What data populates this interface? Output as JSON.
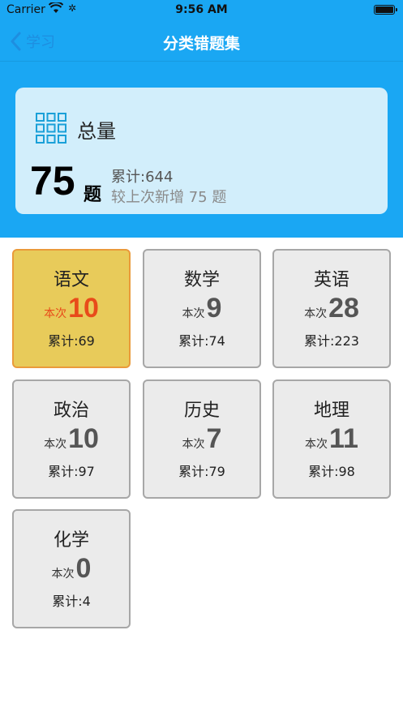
{
  "status_bar": {
    "carrier": "Carrier",
    "time": "9:56 AM"
  },
  "nav": {
    "back_label": "学习",
    "title": "分类错题集"
  },
  "summary": {
    "label": "总量",
    "count": "75",
    "unit": "题",
    "cumulative": "累计:644",
    "increase": "较上次新增 75 题"
  },
  "subjects": [
    {
      "name": "语文",
      "this_label": "本次",
      "count": "10",
      "total": "累计:69",
      "active": true
    },
    {
      "name": "数学",
      "this_label": "本次",
      "count": "9",
      "total": "累计:74",
      "active": false
    },
    {
      "name": "英语",
      "this_label": "本次",
      "count": "28",
      "total": "累计:223",
      "active": false
    },
    {
      "name": "政治",
      "this_label": "本次",
      "count": "10",
      "total": "累计:97",
      "active": false
    },
    {
      "name": "历史",
      "this_label": "本次",
      "count": "7",
      "total": "累计:79",
      "active": false
    },
    {
      "name": "地理",
      "this_label": "本次",
      "count": "11",
      "total": "累计:98",
      "active": false
    },
    {
      "name": "化学",
      "this_label": "本次",
      "count": "0",
      "total": "累计:4",
      "active": false
    }
  ],
  "colors": {
    "header_bg": "#1aa7f3",
    "card_bg": "#d2eefb",
    "tile_bg": "#ebebeb",
    "tile_active_bg": "#e8cb5a",
    "active_count": "#e84b1a",
    "back_link": "#1e8ee0"
  },
  "icons": {
    "wifi": "wifi-icon",
    "activity": "activity-icon",
    "battery": "battery-icon",
    "back": "chevron-left-icon",
    "summary": "grid-icon"
  }
}
